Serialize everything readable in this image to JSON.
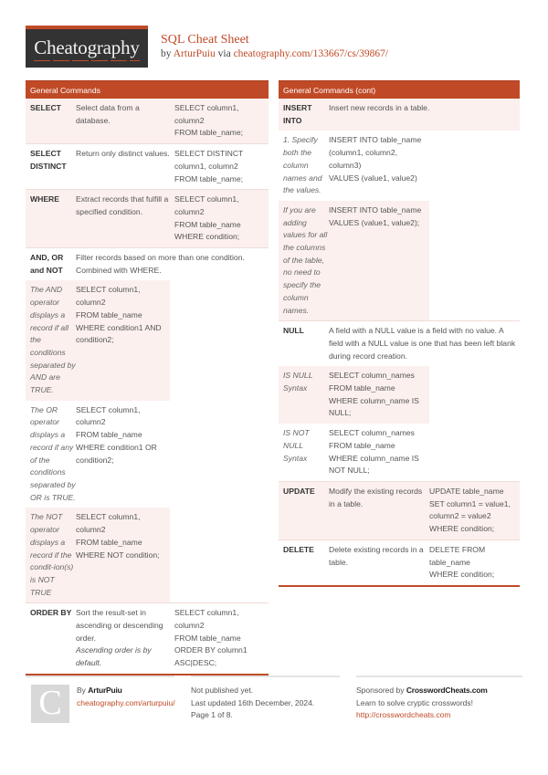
{
  "header": {
    "logo_text": "Cheatography",
    "title": "SQL Cheat Sheet",
    "by_prefix": "by ",
    "author": "ArturPuiu",
    "via_text": " via ",
    "url": "cheatography.com/133667/cs/39867/"
  },
  "left_section": {
    "title": "General Commands",
    "rows": [
      {
        "term": "SELECT",
        "desc": "Select data from a database.",
        "code": [
          "SELECT column1,",
          "column2",
          "FROM table_name;"
        ]
      },
      {
        "term": "SELECT DISTINCT",
        "desc": "Return only distinct values.",
        "code": [
          "SELECT DISTINCT",
          "column1, column2",
          "FROM table_name;"
        ]
      },
      {
        "term": "WHERE",
        "desc": "Extract records that fulfill a specified condition.",
        "code": [
          "SELECT column1,",
          "column2",
          "FROM table_name",
          "WHERE condition;"
        ]
      },
      {
        "term": "AND, OR and NOT",
        "desc": "Filter records based on more than one condition. Combined with WHERE."
      },
      {
        "note": "The AND operator displays a record if all the conditions separated by AND are TRUE.",
        "code": [
          "SELECT column1,",
          "column2",
          "FROM table_name",
          "WHERE condition1 AND",
          "condition2;"
        ]
      },
      {
        "note": "The OR operator displays a record if any of the conditions separated by OR is TRUE.",
        "code": [
          "SELECT column1,",
          "column2",
          "FROM table_name",
          "WHERE condition1 OR",
          "condition2;"
        ]
      },
      {
        "note": "The NOT operator displays a record if the condit-ion(s) is NOT TRUE",
        "code": [
          "SELECT column1,",
          "column2",
          "FROM table_name",
          "WHERE NOT condition;"
        ]
      },
      {
        "term": "ORDER BY",
        "desc": "Sort the result-set in ascending or descending order.",
        "desc_note": "Ascending order is by default.",
        "code": [
          "SELECT column1,",
          "column2",
          "FROM table_name",
          "ORDER BY column1",
          "ASC|DESC;"
        ]
      }
    ]
  },
  "right_section": {
    "title": "General Commands (cont)",
    "rows": [
      {
        "term": "INSERT INTO",
        "desc": "Insert new records in a table."
      },
      {
        "note": "1. Specify both the column names and the values.",
        "code": [
          "INSERT INTO table_name",
          "(column1, column2,",
          "column3)",
          "VALUES (value1, value2)"
        ]
      },
      {
        "note": "If you are adding values for all the columns of the table, no need to specify the column names.",
        "code": [
          "INSERT INTO table_name",
          "VALUES (value1, value2);"
        ]
      },
      {
        "term": "NULL",
        "desc": "A field with a NULL value is a field with no value. A field with a NULL value is one that has been left blank during record creation."
      },
      {
        "note": "IS NULL Syntax",
        "code": [
          "SELECT column_names",
          "FROM table_name",
          "WHERE column_name IS",
          "NULL;"
        ]
      },
      {
        "note": "IS NOT NULL Syntax",
        "code": [
          "SELECT column_names",
          "FROM table_name",
          "WHERE column_name IS",
          "NOT NULL;"
        ]
      },
      {
        "term": "UPDATE",
        "desc": "Modify the existing records in a table.",
        "code": [
          "UPDATE table_name",
          "SET column1 = value1,",
          "column2 = value2",
          "WHERE condition;"
        ]
      },
      {
        "term": "DELETE",
        "desc": "Delete existing records in a table.",
        "code": [
          "DELETE FROM",
          "table_name",
          "WHERE condition;"
        ]
      }
    ]
  },
  "footer": {
    "avatar_letter": "C",
    "by_prefix": "By ",
    "author": "ArturPuiu",
    "author_url": "cheatography.com/arturpuiu/",
    "published": "Not published yet.",
    "updated": "Last updated 16th December, 2024.",
    "page": "Page 1 of 8.",
    "sponsor_prefix": "Sponsored by ",
    "sponsor_name": "CrosswordCheats.com",
    "sponsor_tagline": "Learn to solve cryptic crosswords!",
    "sponsor_url": "http://crosswordcheats.com"
  },
  "colors": {
    "accent": "#c04a27",
    "logo_bg": "#333333",
    "row_shade": "#fbf0ee"
  }
}
